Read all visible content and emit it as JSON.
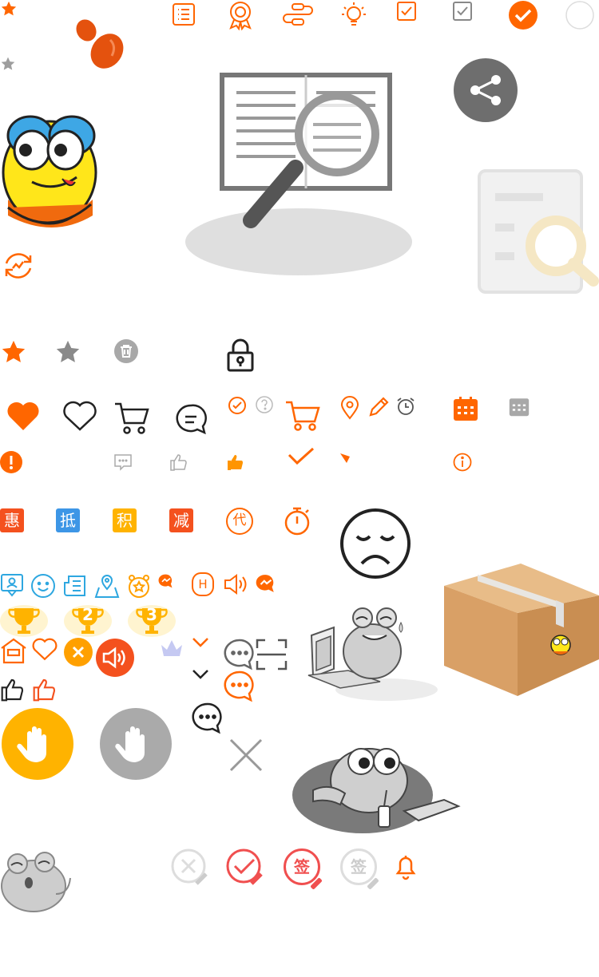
{
  "badges": {
    "hui": "惠",
    "di": "抵",
    "ji": "积",
    "jian": "减",
    "dai": "代",
    "h": "H"
  },
  "trophies": {
    "second": "2",
    "third": "3"
  },
  "seals": {
    "qian_red": "签",
    "qian_gray": "签"
  },
  "colors": {
    "orange": "#FF6600",
    "blue": "#2EA7E0",
    "gold": "#FFB300",
    "gray": "#9E9E9E",
    "dark": "#333333",
    "red": "#F04F4F"
  },
  "icons": [
    "star-icon",
    "list-icon",
    "award-icon",
    "flow-icon",
    "bulb-icon",
    "checkbox-icon",
    "check-circle-icon",
    "share-icon",
    "book-search-icon",
    "doc-search-icon",
    "emoji-face",
    "refresh-icon",
    "trash-icon",
    "lock-icon",
    "heart-icon",
    "cart-icon",
    "chat-icon",
    "location-icon",
    "pencil-icon",
    "alarm-icon",
    "calendar-icon",
    "alert-icon",
    "thumb-up-icon",
    "info-icon",
    "timer-icon",
    "sad-face-icon",
    "box-icon",
    "contact-icon",
    "smile-icon",
    "news-icon",
    "map-icon",
    "volume-icon",
    "trophy-icon",
    "home-icon",
    "close-icon",
    "crown-icon",
    "chevron-down-icon",
    "scan-icon",
    "hand-icon",
    "frog-character",
    "bell-icon"
  ]
}
